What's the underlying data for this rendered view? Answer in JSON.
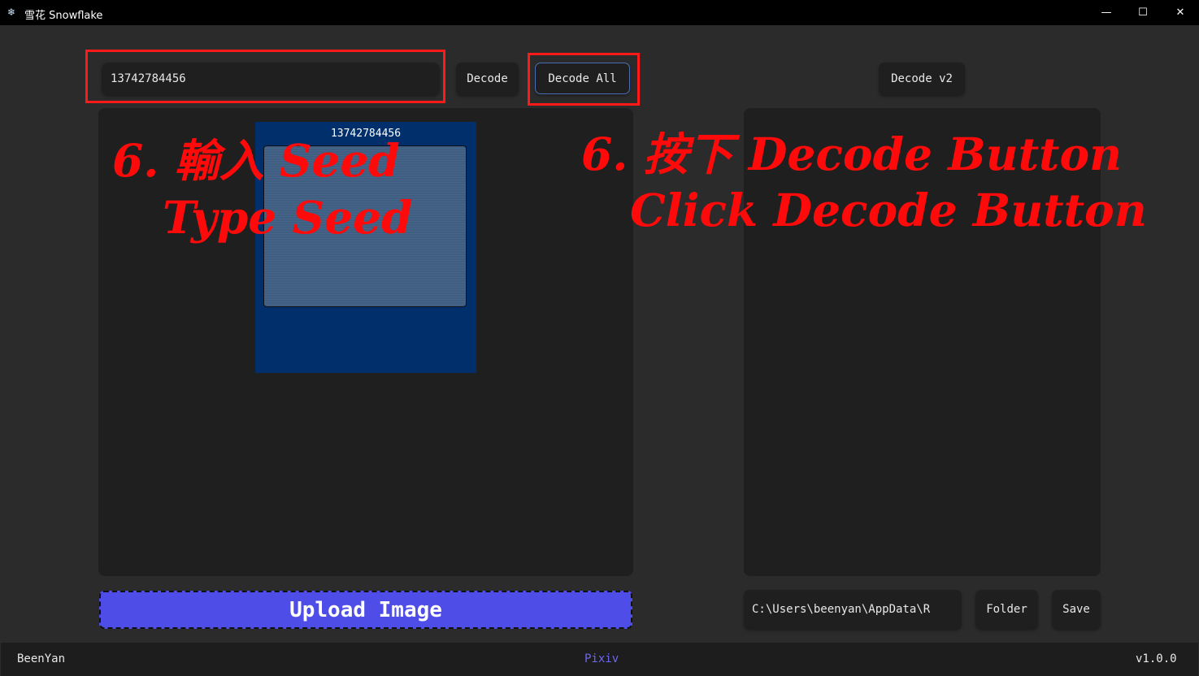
{
  "window": {
    "title": "雪花 Snowflake",
    "icon": "snowflake-app-icon",
    "controls": {
      "minimize": "—",
      "maximize": "☐",
      "close": "✕"
    }
  },
  "toolbar": {
    "seed_value": "13742784456",
    "decode_label": "Decode",
    "decode_all_label": "Decode All",
    "decode_v2_label": "Decode v2"
  },
  "left_panel": {
    "image_caption": "13742784456"
  },
  "bottom": {
    "upload_label": "Upload Image",
    "path_value": "C:\\Users\\beenyan\\AppData\\R",
    "folder_label": "Folder",
    "save_label": "Save"
  },
  "footer": {
    "author": "BeenYan",
    "link": "Pixiv",
    "version": "v1.0.0"
  },
  "annotations": {
    "left_line1": "6. 輸入 Seed",
    "left_line2": "Type Seed",
    "right_line1": "6. 按下 Decode Button",
    "right_line2": "Click  Decode Button"
  },
  "colors": {
    "background": "#2b2b2b",
    "panel": "#1f1f1f",
    "upload_button": "#4f4de8",
    "image_card": "#002f6c",
    "annotation": "#ff0a0a",
    "link": "#6b68f0"
  }
}
